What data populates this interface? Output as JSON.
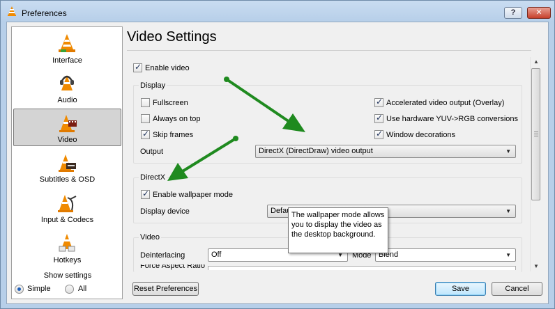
{
  "window": {
    "title": "Preferences",
    "help_label": "?",
    "close_label": "✕"
  },
  "sidebar": {
    "items": [
      {
        "label": "Interface",
        "icon": "vlc-cone-icon"
      },
      {
        "label": "Audio",
        "icon": "headphones-cone-icon"
      },
      {
        "label": "Video",
        "icon": "film-cone-icon",
        "selected": true
      },
      {
        "label": "Subtitles & OSD",
        "icon": "subtitles-cone-icon"
      },
      {
        "label": "Input & Codecs",
        "icon": "cable-cone-icon"
      },
      {
        "label": "Hotkeys",
        "icon": "hotkeys-cone-icon"
      }
    ],
    "show_settings": {
      "legend": "Show settings",
      "simple_label": "Simple",
      "all_label": "All",
      "selected": "Simple"
    }
  },
  "main": {
    "title": "Video Settings",
    "enable_video_label": "Enable video",
    "enable_video_checked": true,
    "display": {
      "legend": "Display",
      "fullscreen_label": "Fullscreen",
      "always_on_top_label": "Always on top",
      "skip_frames_label": "Skip frames",
      "accel_label": "Accelerated video output (Overlay)",
      "yuv_label": "Use hardware YUV->RGB conversions",
      "decorations_label": "Window decorations",
      "output_label": "Output",
      "output_value": "DirectX (DirectDraw) video output"
    },
    "directx": {
      "legend": "DirectX",
      "wallpaper_label": "Enable wallpaper mode",
      "device_label": "Display device",
      "device_value": "Defau"
    },
    "video": {
      "legend": "Video",
      "deinterlacing_label": "Deinterlacing",
      "deinterlacing_value": "Off",
      "mode_label": "Mode",
      "mode_value": "Blend",
      "aspect_label": "Force Aspect Ratio"
    }
  },
  "tooltip": {
    "text": "The wallpaper mode allows you to display the video as the desktop background."
  },
  "buttons": {
    "reset": "Reset Preferences",
    "save": "Save",
    "cancel": "Cancel"
  },
  "colors": {
    "arrow": "#1f8a1f",
    "accent": "#1f5fb8"
  }
}
